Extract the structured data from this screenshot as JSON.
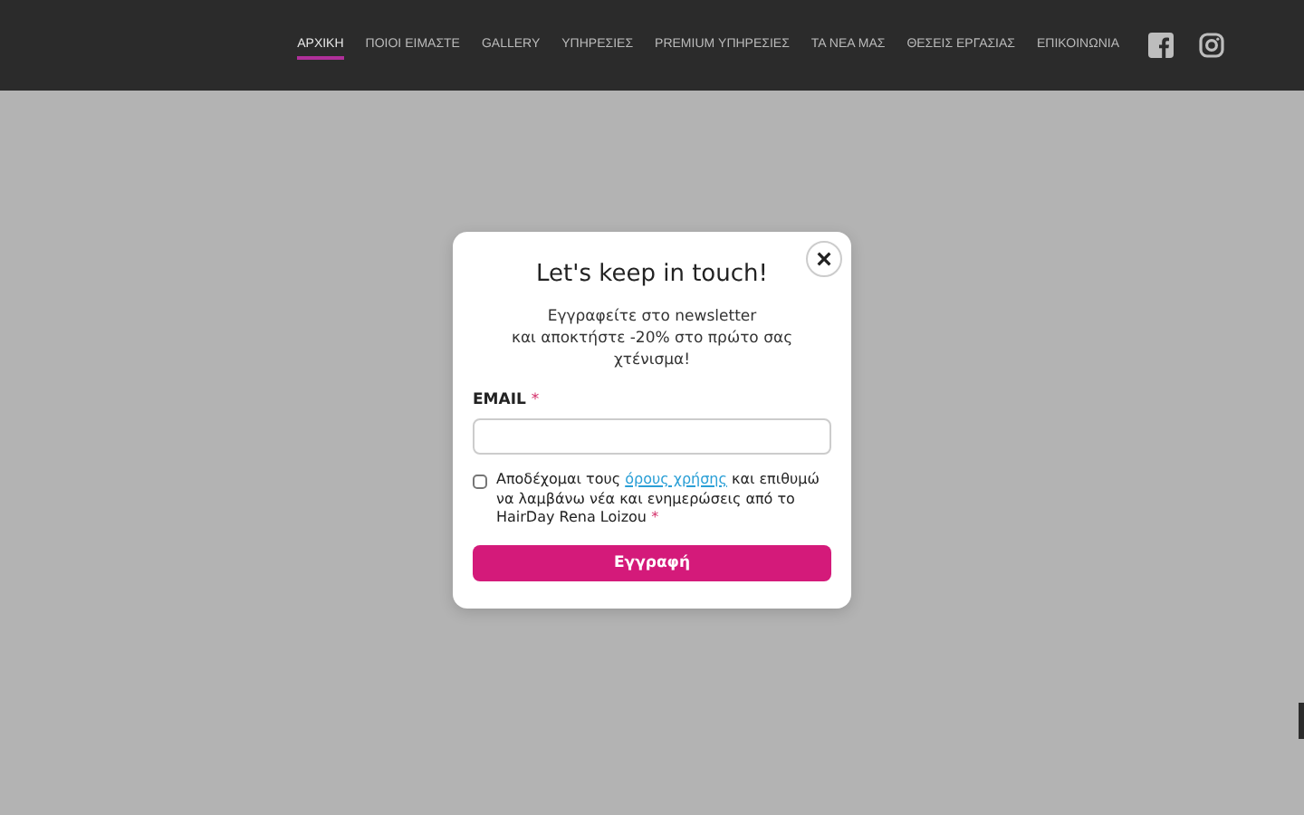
{
  "nav": {
    "items": [
      {
        "label": "ΑΡΧΙΚΗ",
        "selected": true
      },
      {
        "label": "ΠΟΙΟΙ ΕΙΜΑΣΤΕ",
        "selected": false
      },
      {
        "label": "GALLERY",
        "selected": false
      },
      {
        "label": "ΥΠΗΡΕΣΙΕΣ",
        "selected": false
      },
      {
        "label": "PREMIUM ΥΠΗΡΕΣΙΕΣ",
        "selected": false
      },
      {
        "label": "ΤΑ ΝΕΑ ΜΑΣ",
        "selected": false
      },
      {
        "label": "ΘΕΣΕΙΣ ΕΡΓΑΣΙΑΣ",
        "selected": false
      },
      {
        "label": "ΕΠΙΚΟΙΝΩΝΙΑ",
        "selected": false
      }
    ]
  },
  "popup": {
    "close": "×",
    "title": "Let's keep in touch!",
    "subtitle": [
      "Εγγραφείτε στο newsletter",
      "και αποκτήστε -20% στο πρώτο σας χτένισμα!"
    ],
    "email": {
      "label": "EMAIL",
      "required_mark": "*"
    },
    "consent": {
      "checked": false,
      "before": "Αποδέχομαι τους ",
      "link": "όρους χρήσης",
      "after": " και επιθυμώ να λαμβάνω νέα και ενημερώσεις από το HairDay Rena Loizou",
      "required_mark": "*"
    },
    "submit": "Εγγραφή"
  }
}
